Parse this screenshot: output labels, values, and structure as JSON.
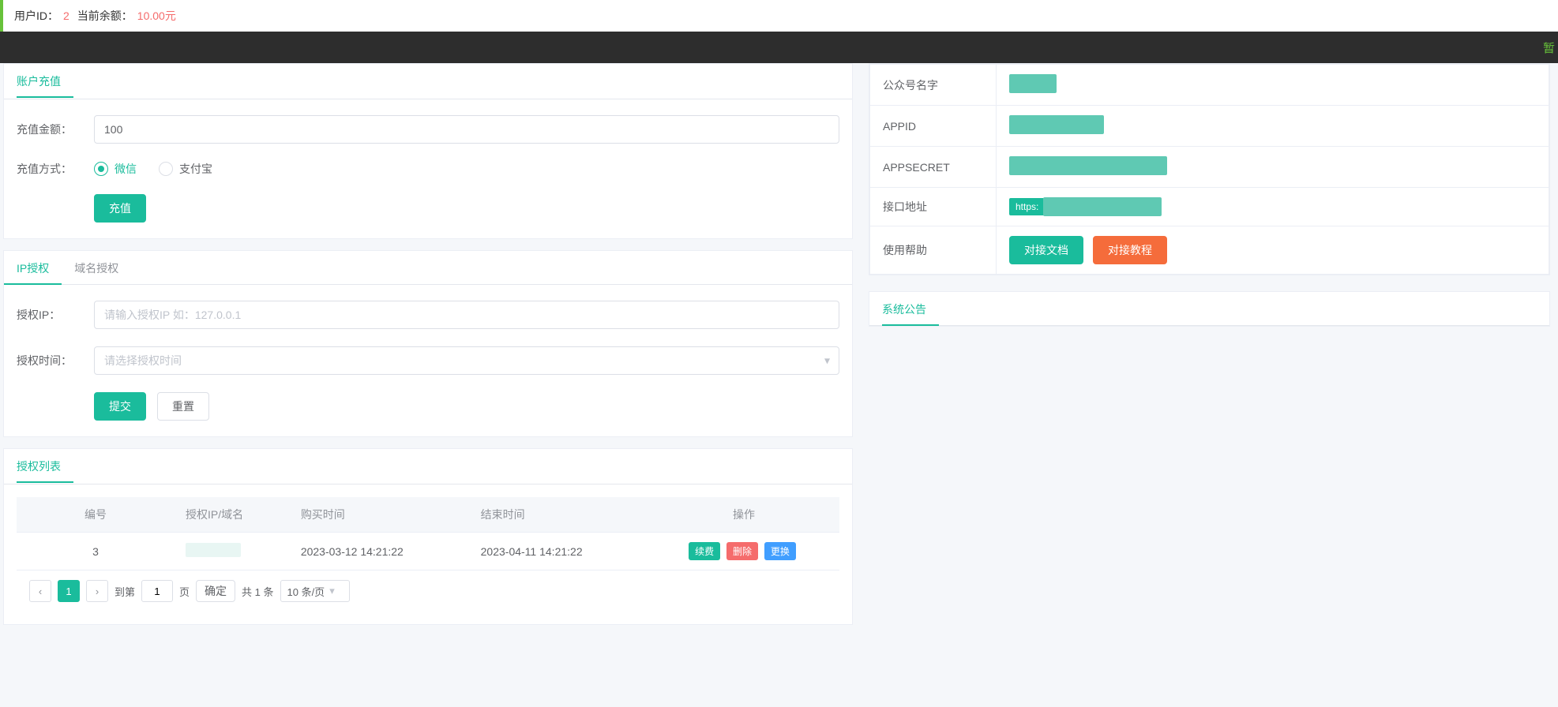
{
  "topbar": {
    "user_id_label": "用户ID：",
    "user_id": "2",
    "balance_label": "当前余额：",
    "balance": "10.00元"
  },
  "marquee": {
    "text": "暂"
  },
  "recharge": {
    "title": "账户充值",
    "amount_label": "充值金额：",
    "amount_value": "100",
    "method_label": "充值方式：",
    "method_wechat": "微信",
    "method_alipay": "支付宝",
    "submit": "充值"
  },
  "auth": {
    "tab_ip": "IP授权",
    "tab_domain": "域名授权",
    "ip_label": "授权IP：",
    "ip_placeholder": "请输入授权IP 如：127.0.0.1",
    "time_label": "授权时间：",
    "time_placeholder": "请选择授权时间",
    "submit": "提交",
    "reset": "重置"
  },
  "list": {
    "title": "授权列表",
    "columns": [
      "编号",
      "授权IP/域名",
      "购买时间",
      "结束时间",
      "操作"
    ],
    "rows": [
      {
        "id": "3",
        "target": "",
        "buy": "2023-03-12 14:21:22",
        "end": "2023-04-11 14:21:22"
      }
    ],
    "actions": {
      "renew": "续费",
      "delete": "删除",
      "replace": "更换"
    },
    "pager": {
      "goto_label": "到第",
      "page_value": "1",
      "page_unit": "页",
      "confirm": "确定",
      "total": "共 1 条",
      "size": "10 条/页"
    }
  },
  "info": {
    "rows": {
      "name_label": "公众号名字",
      "appid_label": "APPID",
      "secret_label": "APPSECRET",
      "api_label": "接口地址",
      "api_prefix": "https:",
      "help_label": "使用帮助",
      "doc_btn": "对接文档",
      "tutorial_btn": "对接教程"
    }
  },
  "notice": {
    "title": "系统公告"
  }
}
